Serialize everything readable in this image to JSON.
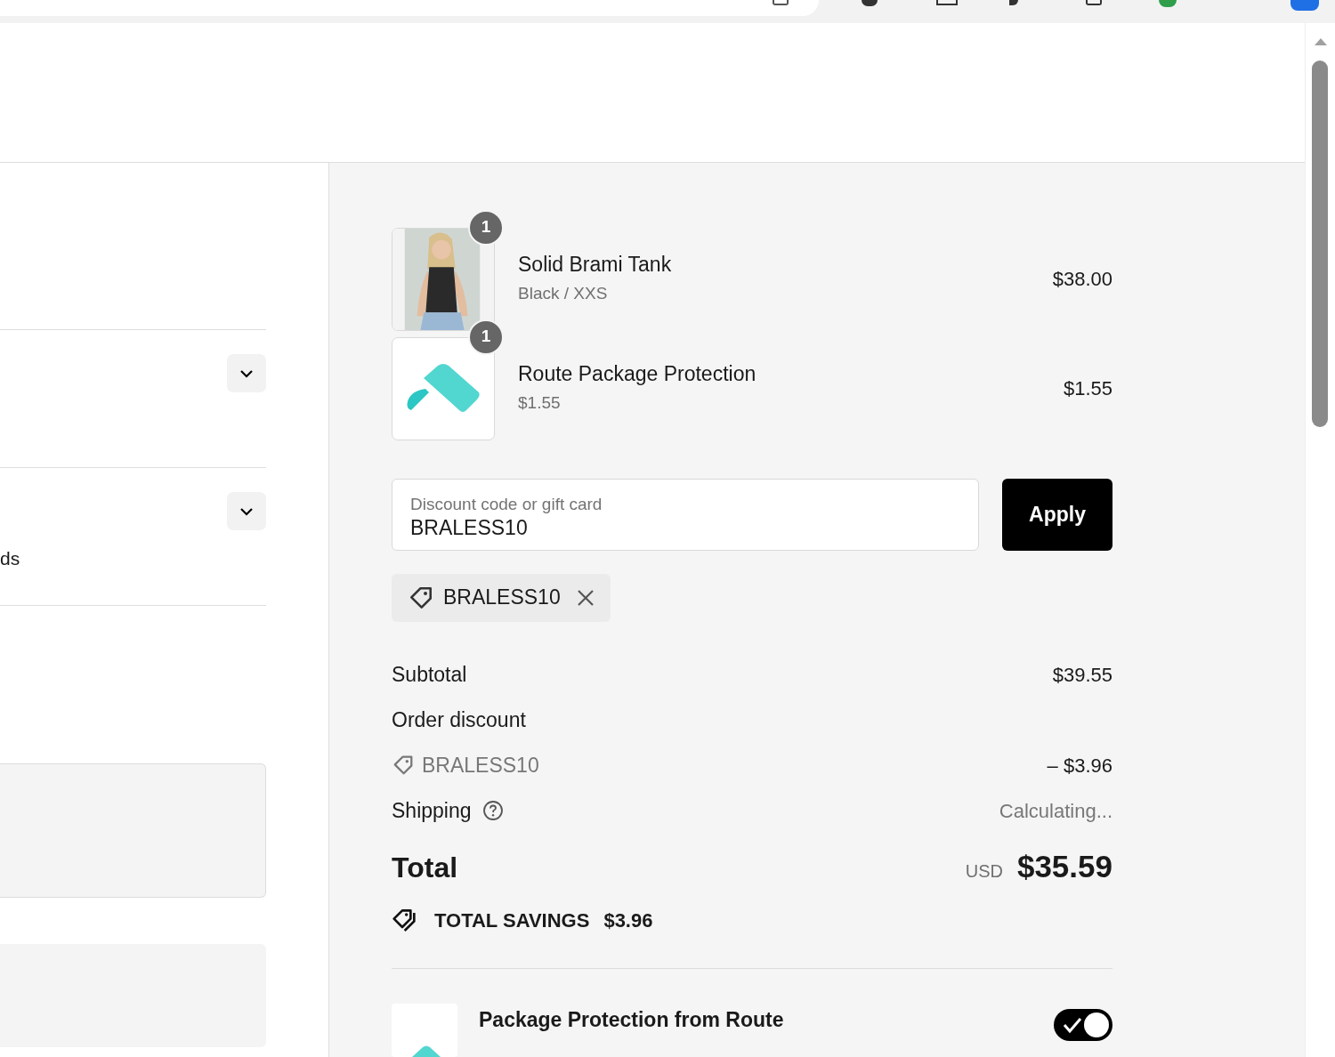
{
  "left_panel": {
    "fragment_text": "ds"
  },
  "items": [
    {
      "quantity": "1",
      "name": "Solid Brami Tank",
      "detail": "Black / XXS",
      "price": "$38.00"
    },
    {
      "kind": "logo",
      "quantity": "1",
      "name": "Route Package Protection",
      "detail": "$1.55",
      "price": "$1.55"
    }
  ],
  "discount": {
    "placeholder": "Discount code or gift card",
    "value": "BRALESS10",
    "button": "Apply"
  },
  "applied_codes": [
    {
      "code": "BRALESS10"
    }
  ],
  "summary": [
    {
      "kind": "plain",
      "label": "Subtotal",
      "value": "$39.55"
    },
    {
      "kind": "heading",
      "label": "Order discount"
    },
    {
      "kind": "code",
      "label": "BRALESS10",
      "value": "– $3.96"
    },
    {
      "kind": "help",
      "label": "Shipping",
      "value": "Calculating..."
    }
  ],
  "total": {
    "label": "Total",
    "currency": "USD",
    "amount": "$35.59"
  },
  "savings": {
    "label": "TOTAL SAVINGS",
    "amount": "$3.96"
  },
  "protection": {
    "title": "Package Protection from Route",
    "on": true
  }
}
